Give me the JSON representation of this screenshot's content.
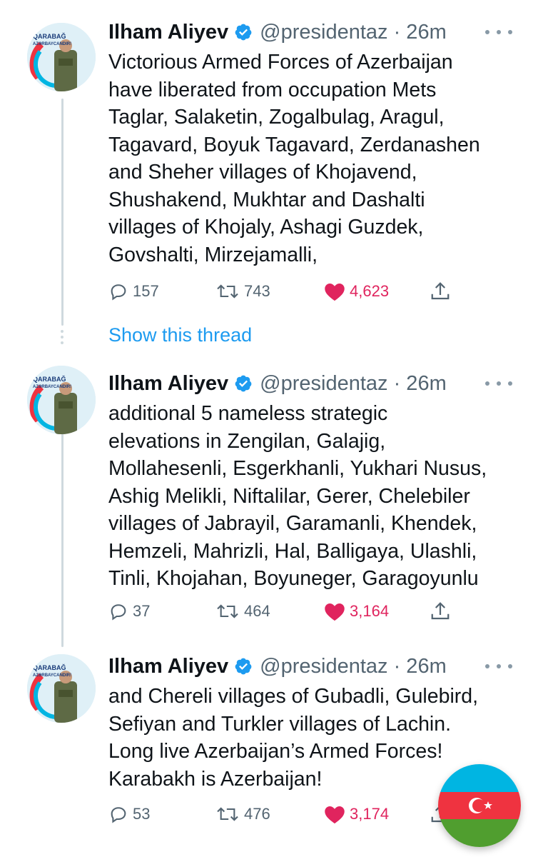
{
  "tweets": [
    {
      "avatar_text": [
        "QARABAĞ",
        "AZƏRBAYCANDIR!"
      ],
      "name": "Ilham Aliyev",
      "handle": "@presidentaz · 26m",
      "lines": [
        "Victorious Armed Forces of Azerbaijan",
        "have liberated from occupation Mets",
        "Taglar, Salaketin, Zogalbulag, Aragul,",
        "Tagavard, Boyuk Tagavard, Zerdanashen",
        "and Sheher villages of Khojavend,",
        "Shushakend, Mukhtar and Dashalti",
        "villages of Khojaly, Ashagi Guzdek,",
        "Govshalti, Mirzejamalli,"
      ],
      "replies": "157",
      "retweets": "743",
      "likes": "4,623"
    },
    {
      "avatar_text": [
        "QARABAĞ",
        "AZƏRBAYCANDIR!"
      ],
      "name": "Ilham Aliyev",
      "handle": "@presidentaz · 26m",
      "lines": [
        "additional 5 nameless strategic",
        "elevations in Zengilan, Galajig,",
        "Mollahesenli, Esgerkhanli, Yukhari Nusus,",
        "Ashig Melikli, Niftalilar, Gerer, Chelebiler",
        "villages of Jabrayil, Garamanli, Khendek,",
        "Hemzeli, Mahrizli, Hal, Balligaya, Ulashli,",
        "Tinli, Khojahan, Boyuneger, Garagoyunlu"
      ],
      "replies": "37",
      "retweets": "464",
      "likes": "3,164"
    },
    {
      "avatar_text": [
        "QARABAĞ",
        "AZƏRBAYCANDIR!"
      ],
      "name": "Ilham Aliyev",
      "handle": "@presidentaz · 26m",
      "lines": [
        "and Chereli villages of Gubadli, Gulebird,",
        "Sefiyan and Turkler villages of Lachin.",
        "Long live Azerbaijan’s Armed Forces!",
        "Karabakh is Azerbaijan!"
      ],
      "replies": "53",
      "retweets": "476",
      "likes": "3,174"
    }
  ],
  "show_thread": "Show this thread",
  "colors": {
    "link": "#1d9bf0",
    "like": "#e0245e",
    "muted": "#536471",
    "flag_blue": "#00b5e2",
    "flag_red": "#ef3340",
    "flag_green": "#509e2f"
  },
  "icons": [
    "verified-badge-icon",
    "more-icon",
    "reply-icon",
    "retweet-icon",
    "like-icon",
    "share-icon",
    "azerbaijan-flag-icon"
  ]
}
